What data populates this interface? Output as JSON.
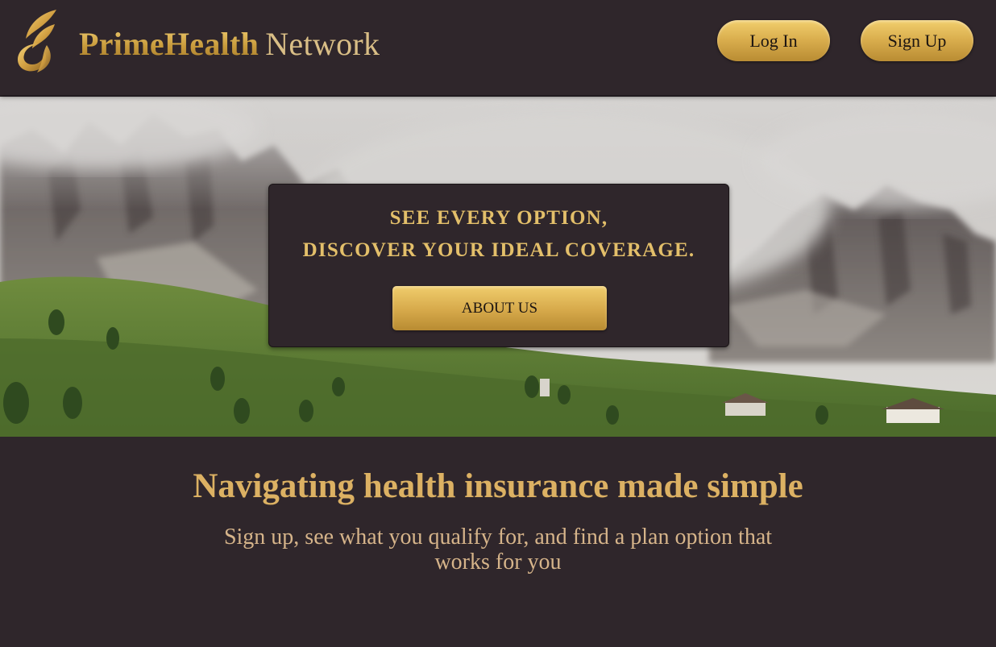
{
  "header": {
    "brand_bold": "PrimeHealth",
    "brand_light": "Network",
    "login_label": "Log In",
    "signup_label": "Sign Up"
  },
  "hero": {
    "headline_line1": "SEE EVERY OPTION,",
    "headline_line2": "DISCOVER YOUR IDEAL COVERAGE.",
    "about_label": "ABOUT US"
  },
  "content": {
    "title": "Navigating health insurance made simple",
    "subtitle": "Sign up, see what you qualify for, and find a plan option that works for you"
  },
  "colors": {
    "background": "#2f262b",
    "gold": "#dcb163",
    "gold_button_top": "#f2cf6d",
    "gold_button_bottom": "#b98c33"
  },
  "icons": {
    "logo": "gold-flame-logo-icon"
  }
}
